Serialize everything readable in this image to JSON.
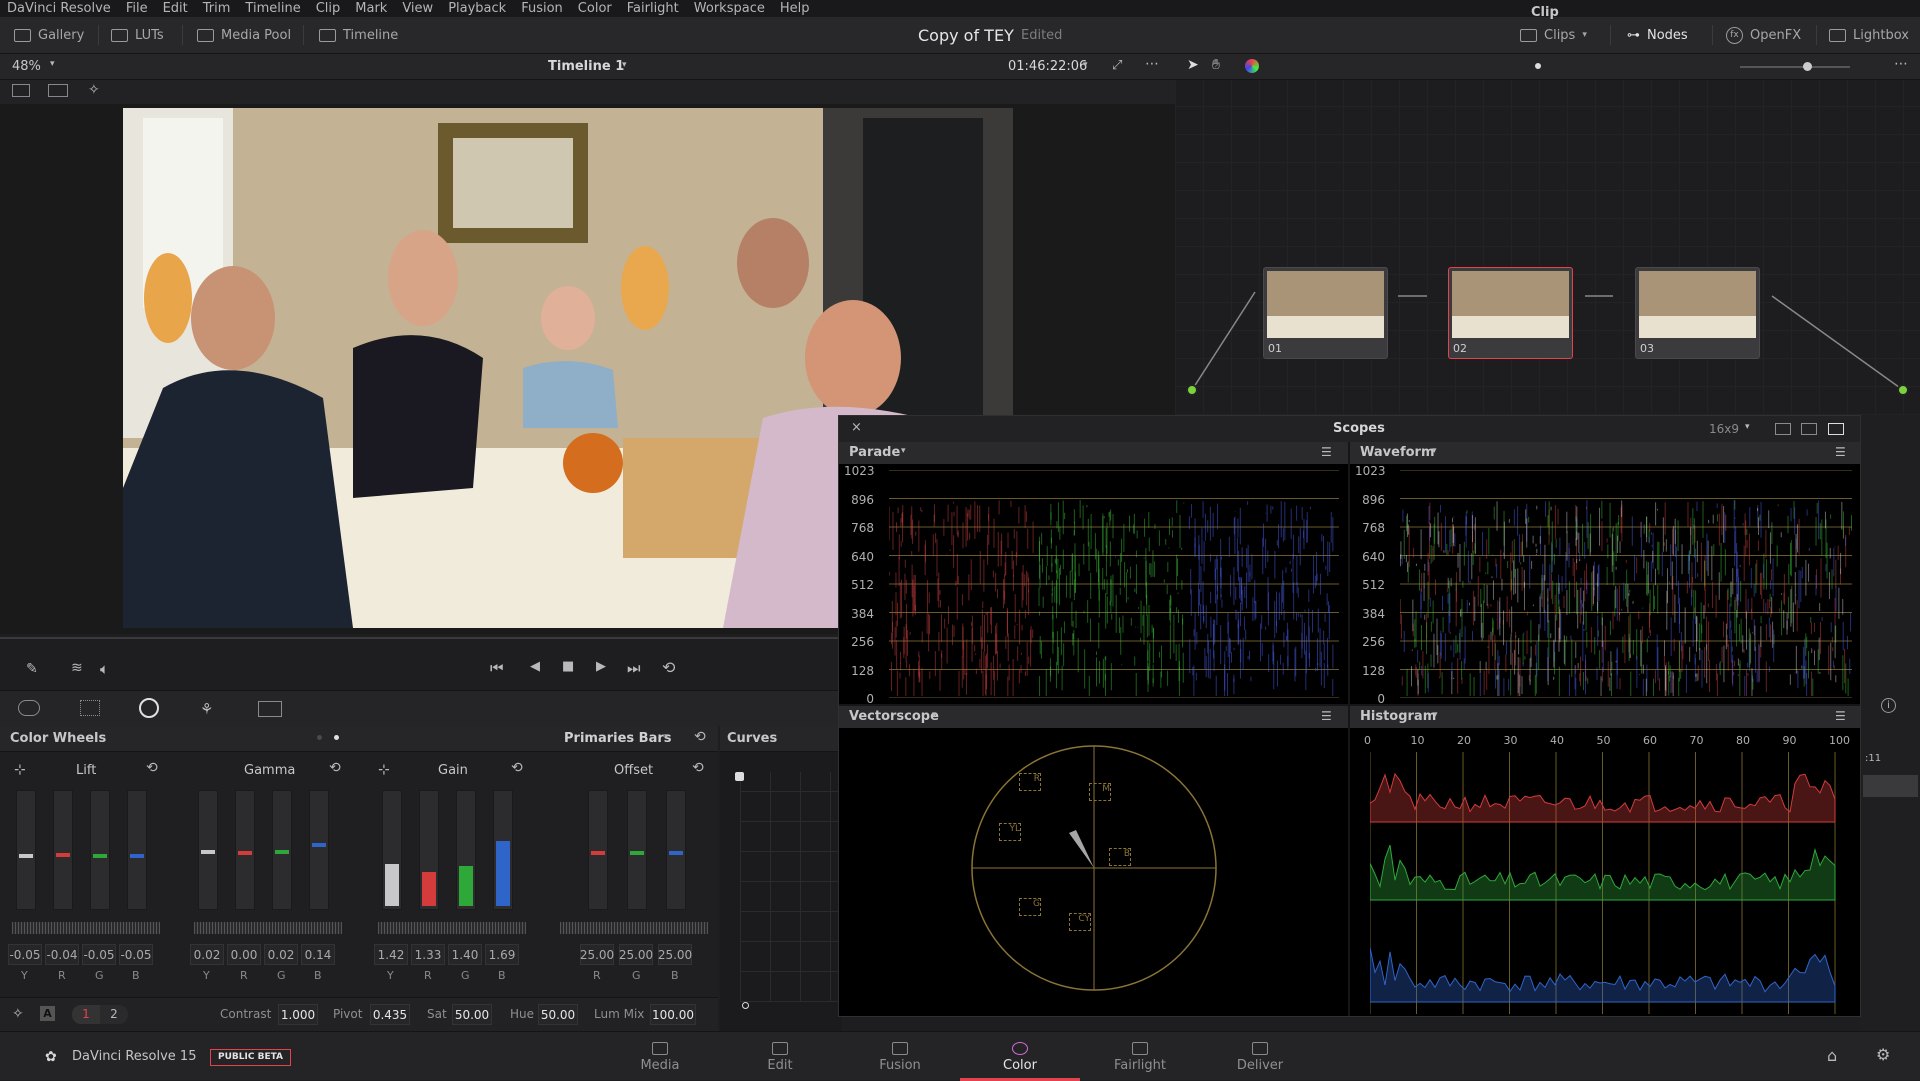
{
  "menu": [
    "DaVinci Resolve",
    "File",
    "Edit",
    "Trim",
    "Timeline",
    "Clip",
    "Mark",
    "View",
    "Playback",
    "Fusion",
    "Color",
    "Fairlight",
    "Workspace",
    "Help"
  ],
  "toolbar": {
    "gallery": "Gallery",
    "luts": "LUTs",
    "media_pool": "Media Pool",
    "timeline": "Timeline",
    "project_title": "Copy of TEY",
    "project_status": "Edited",
    "clips": "Clips",
    "nodes": "Nodes",
    "openfx": "OpenFX",
    "lightbox": "Lightbox"
  },
  "viewer": {
    "zoom": "48%",
    "timeline_name": "Timeline 1",
    "timecode": "01:46:22:06"
  },
  "node_editor": {
    "mode": "Clip",
    "nodes": [
      {
        "label": "01"
      },
      {
        "label": "02"
      },
      {
        "label": "03"
      }
    ]
  },
  "color_wheels": {
    "title": "Color Wheels",
    "mode": "Primaries Bars",
    "wheels": [
      {
        "name": "Lift",
        "channels": [
          "Y",
          "R",
          "G",
          "B"
        ],
        "values": [
          "-0.05",
          "-0.04",
          "-0.05",
          "-0.05"
        ]
      },
      {
        "name": "Gamma",
        "channels": [
          "Y",
          "R",
          "G",
          "B"
        ],
        "values": [
          "0.02",
          "0.00",
          "0.02",
          "0.14"
        ]
      },
      {
        "name": "Gain",
        "channels": [
          "Y",
          "R",
          "G",
          "B"
        ],
        "values": [
          "1.42",
          "1.33",
          "1.40",
          "1.69"
        ]
      },
      {
        "name": "Offset",
        "channels": [
          "R",
          "G",
          "B"
        ],
        "values": [
          "25.00",
          "25.00",
          "25.00"
        ]
      }
    ],
    "page_tabs": [
      "1",
      "2"
    ],
    "contrast_label": "Contrast",
    "contrast": "1.000",
    "pivot_label": "Pivot",
    "pivot": "0.435",
    "sat_label": "Sat",
    "sat": "50.00",
    "hue_label": "Hue",
    "hue": "50.00",
    "lummix_label": "Lum Mix",
    "lummix": "100.00"
  },
  "curves": {
    "title": "Curves"
  },
  "scopes": {
    "title": "Scopes",
    "aspect": "16x9",
    "parade": {
      "title": "Parade",
      "ticks": [
        "1023",
        "896",
        "768",
        "640",
        "512",
        "384",
        "256",
        "128",
        "0"
      ]
    },
    "waveform": {
      "title": "Waveform",
      "ticks": [
        "1023",
        "896",
        "768",
        "640",
        "512",
        "384",
        "256",
        "128",
        "0"
      ]
    },
    "vectorscope": {
      "title": "Vectorscope",
      "targets": [
        "R",
        "M",
        "YL",
        "B",
        "G",
        "CY"
      ]
    },
    "histogram": {
      "title": "Histogram",
      "ticks": [
        "0",
        "10",
        "20",
        "30",
        "40",
        "50",
        "60",
        "70",
        "80",
        "90",
        "100"
      ]
    }
  },
  "right_edge": {
    "time": ":11"
  },
  "footer": {
    "app": "DaVinci Resolve 15",
    "badge": "PUBLIC BETA",
    "nav": [
      "Media",
      "Edit",
      "Fusion",
      "Color",
      "Fairlight",
      "Deliver"
    ],
    "active": "Color"
  },
  "colors": {
    "accent": "#e4434b",
    "red": "#d43b3b",
    "green": "#2fa83a",
    "blue": "#2f65c9",
    "scope_grid": "#6b5a2a"
  }
}
